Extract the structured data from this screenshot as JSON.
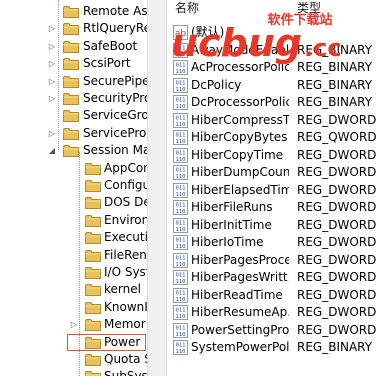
{
  "tree": {
    "items": [
      {
        "label": "Remote Ass",
        "expander": "none"
      },
      {
        "label": "RtlQueryRe",
        "expander": "collapsed"
      },
      {
        "label": "SafeBoot",
        "expander": "collapsed"
      },
      {
        "label": "ScsiPort",
        "expander": "collapsed"
      },
      {
        "label": "SecurePipe",
        "expander": "collapsed"
      },
      {
        "label": "SecurityPro",
        "expander": "collapsed"
      },
      {
        "label": "ServiceGrou",
        "expander": "none"
      },
      {
        "label": "ServiceProv",
        "expander": "collapsed"
      },
      {
        "label": "Session Ma",
        "expander": "expanded"
      },
      {
        "label": "AppCom",
        "expander": "none"
      },
      {
        "label": "Configu",
        "expander": "none"
      },
      {
        "label": "DOS De",
        "expander": "none"
      },
      {
        "label": "Environ",
        "expander": "none"
      },
      {
        "label": "Executiv",
        "expander": "none"
      },
      {
        "label": "FileRen",
        "expander": "none"
      },
      {
        "label": "I/O Syst",
        "expander": "none"
      },
      {
        "label": "kernel",
        "expander": "none"
      },
      {
        "label": "KnownI",
        "expander": "none"
      },
      {
        "label": "Memor",
        "expander": "collapsed"
      },
      {
        "label": "Power",
        "expander": "none",
        "selected": true
      },
      {
        "label": "Quota S",
        "expander": "none"
      },
      {
        "label": "SubSyst",
        "expander": "none"
      }
    ]
  },
  "values": {
    "header": {
      "name": "名称",
      "type": "类型"
    },
    "rows": [
      {
        "name": "(默认)",
        "type": "",
        "kind": "string"
      },
      {
        "name": "AwayModeEnabled",
        "type": "REG_BINARY",
        "kind": "binary"
      },
      {
        "name": "AcProcessorPolicy",
        "type": "REG_BINARY",
        "kind": "binary"
      },
      {
        "name": "DcPolicy",
        "type": "REG_BINARY",
        "kind": "binary"
      },
      {
        "name": "DcProcessorPolicy",
        "type": "REG_BINARY",
        "kind": "binary"
      },
      {
        "name": "HiberCompressTi...",
        "type": "REG_DWORD",
        "kind": "binary"
      },
      {
        "name": "HiberCopyBytes",
        "type": "REG_QWORD",
        "kind": "binary"
      },
      {
        "name": "HiberCopyTime",
        "type": "REG_DWORD",
        "kind": "binary"
      },
      {
        "name": "HiberDumpCount",
        "type": "REG_DWORD",
        "kind": "binary"
      },
      {
        "name": "HiberElapsedTime",
        "type": "REG_DWORD",
        "kind": "binary"
      },
      {
        "name": "HiberFileRuns",
        "type": "REG_DWORD",
        "kind": "binary"
      },
      {
        "name": "HiberInitTime",
        "type": "REG_DWORD",
        "kind": "binary"
      },
      {
        "name": "HiberIoTime",
        "type": "REG_DWORD",
        "kind": "binary"
      },
      {
        "name": "HiberPagesProce...",
        "type": "REG_DWORD",
        "kind": "binary"
      },
      {
        "name": "HiberPagesWritt...",
        "type": "REG_DWORD",
        "kind": "binary"
      },
      {
        "name": "HiberReadTime",
        "type": "REG_DWORD",
        "kind": "binary"
      },
      {
        "name": "HiberResumeAp...",
        "type": "REG_DWORD",
        "kind": "binary"
      },
      {
        "name": "PowerSettingPro...",
        "type": "REG_DWORD",
        "kind": "binary"
      },
      {
        "name": "SystemPowerPolicy",
        "type": "REG_BINARY",
        "kind": "binary"
      }
    ]
  },
  "watermark": {
    "brand": "ucbug",
    "suffix": ".cc",
    "caption": "软件下载站",
    "color": "#e8382a"
  }
}
